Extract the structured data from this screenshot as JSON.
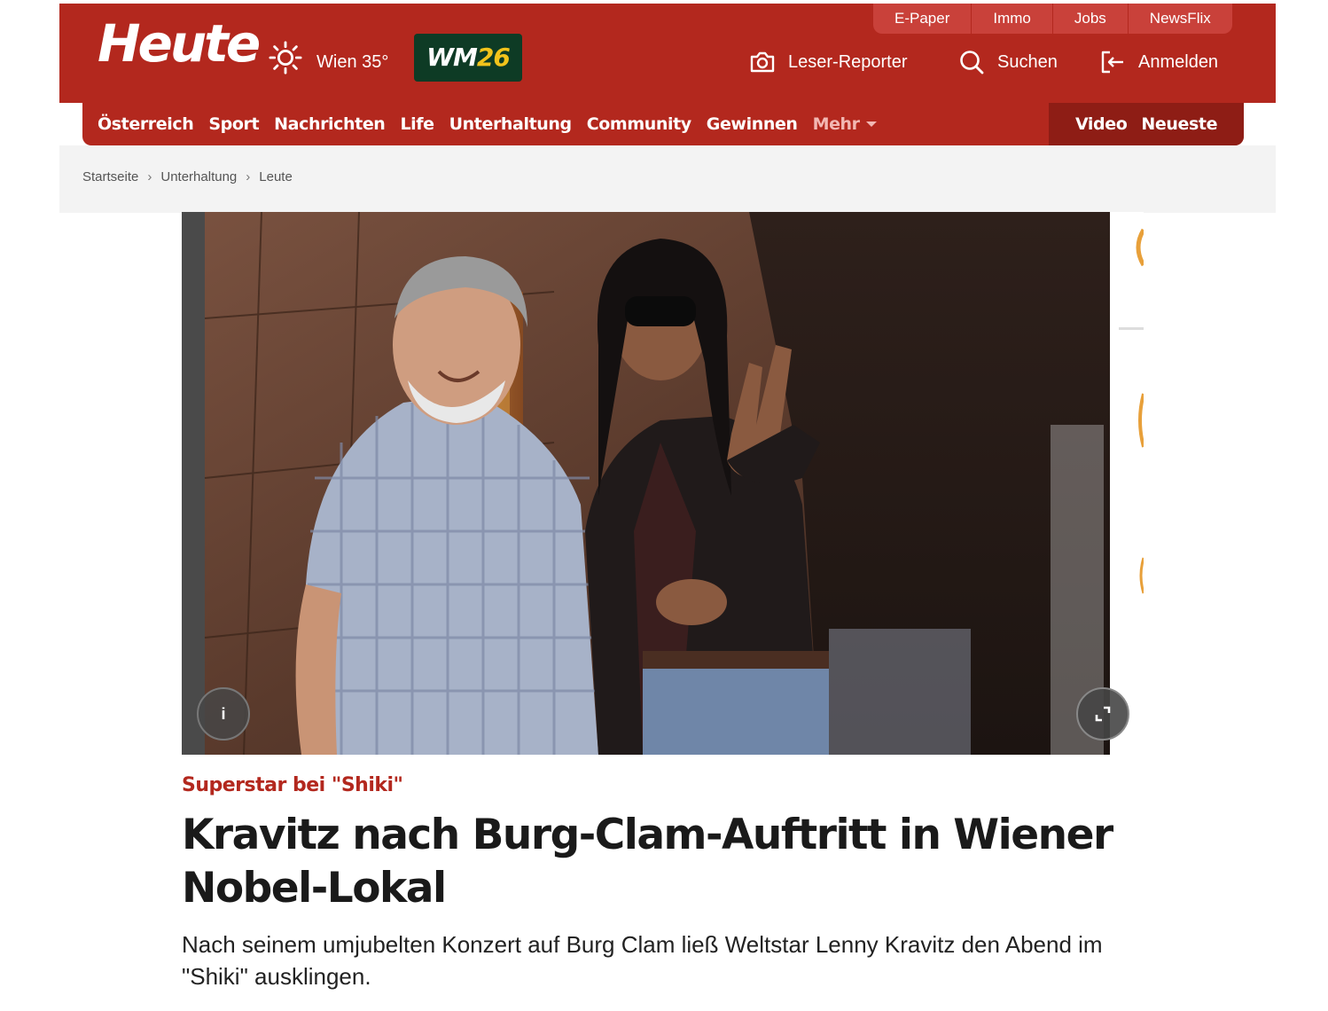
{
  "header": {
    "logo": "Heute",
    "weather": "Wien 35°",
    "wm_badge": {
      "prefix": "WM",
      "number": "26"
    },
    "top_links": [
      "E-Paper",
      "Immo",
      "Jobs",
      "NewsFlix"
    ],
    "actions": {
      "reporter": "Leser-Reporter",
      "search": "Suchen",
      "login": "Anmelden"
    }
  },
  "nav": {
    "items": [
      "Österreich",
      "Sport",
      "Nachrichten",
      "Life",
      "Unterhaltung",
      "Community",
      "Gewinnen"
    ],
    "more": "Mehr",
    "right": [
      "Video",
      "Neueste"
    ]
  },
  "breadcrumb": [
    "Startseite",
    "Unterhaltung",
    "Leute"
  ],
  "hero": {
    "info_label": "i"
  },
  "article": {
    "kicker": "Superstar bei \"Shiki\"",
    "headline": "Kravitz nach Burg-Clam-Auftritt in Wiener Nobel-Lokal",
    "lead": "Nach seinem umjubelten Konzert auf Burg Clam ließ Weltstar Lenny Kravitz den Abend im \"Shiki\" ausklingen."
  },
  "colors": {
    "brand_red": "#b3281e",
    "dark_red": "#8e1d15",
    "wm_green": "#0e3b25",
    "wm_yellow": "#f2c31b"
  }
}
